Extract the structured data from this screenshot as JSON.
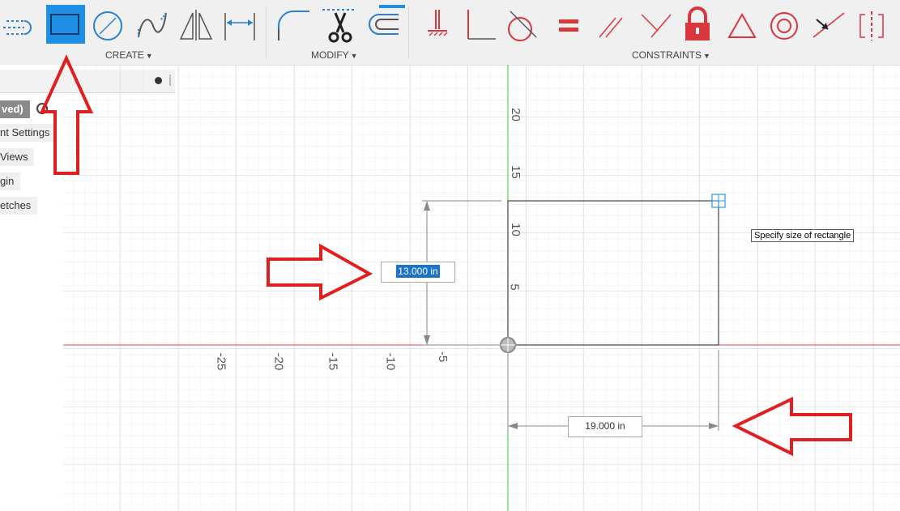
{
  "toolbar": {
    "groups": {
      "create": "CREATE",
      "modify": "MODIFY",
      "constraints": "CONSTRAINTS"
    },
    "caret": "▼"
  },
  "browser": {
    "items": [
      {
        "label": "ved)"
      },
      {
        "label": "nt Settings"
      },
      {
        "label": "Views"
      },
      {
        "label": "gin"
      },
      {
        "label": "etches"
      }
    ]
  },
  "canvas": {
    "x_ticks": [
      "-25",
      "-20",
      "-15",
      "-10",
      "-5"
    ],
    "y_ticks": [
      "20",
      "15",
      "10",
      "5"
    ],
    "height_input": "13.000 in",
    "width_input": "19.000 in",
    "tooltip": "Specify size of rectangle"
  },
  "colors": {
    "accent_blue": "#1a73c8",
    "constraint_red": "#d9363e",
    "annotation_red": "#e02020",
    "x_axis": "#e04a4a",
    "y_axis": "#33cc33"
  }
}
